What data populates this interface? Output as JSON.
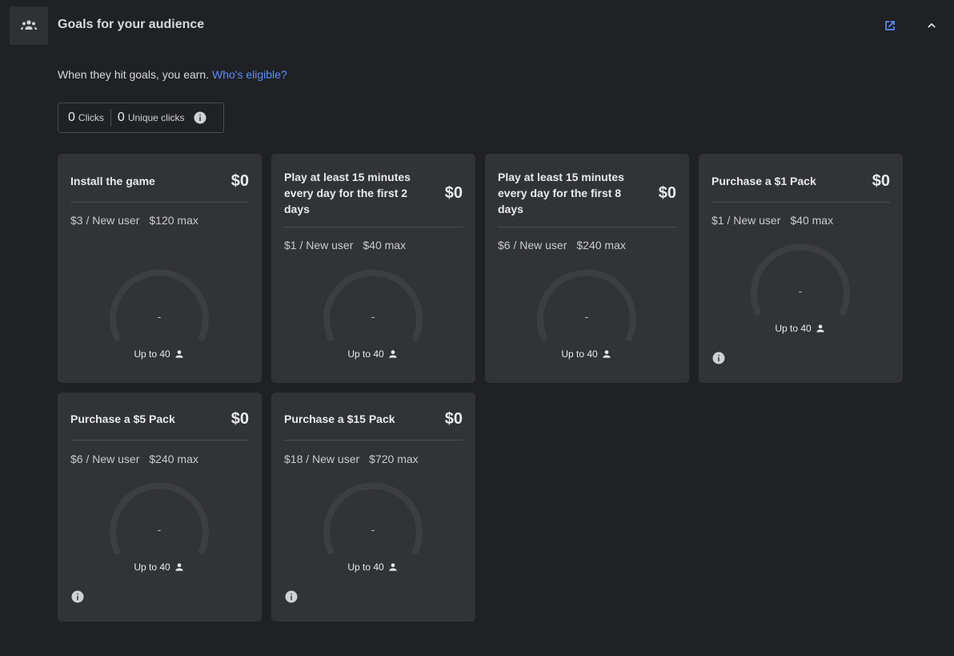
{
  "header": {
    "title": "Goals for your audience",
    "icon": "audience-group-icon",
    "external_icon": "open-in-new-icon",
    "collapse_icon": "chevron-up-icon"
  },
  "subtitle": {
    "text": "When they hit goals, you earn.",
    "link": "Who's eligible?"
  },
  "stats": {
    "clicks_value": "0",
    "clicks_label": "Clicks",
    "unique_value": "0",
    "unique_label": "Unique clicks"
  },
  "colors": {
    "background": "#202124",
    "card": "#323336",
    "link": "#5b8ff9",
    "gauge_track": "#3d3e42"
  },
  "goals": [
    {
      "title": "Install the game",
      "amount": "$0",
      "rate": "$3 / New user",
      "max": "$120 max",
      "gauge_value": "-",
      "gauge_caption": "Up to 40"
    },
    {
      "title": "Play at least 15 minutes every day for the first 2 days",
      "amount": "$0",
      "rate": "$1 / New user",
      "max": "$40 max",
      "gauge_value": "-",
      "gauge_caption": "Up to 40"
    },
    {
      "title": "Play at least 15 minutes every day for the first 8 days",
      "amount": "$0",
      "rate": "$6 / New user",
      "max": "$240 max",
      "gauge_value": "-",
      "gauge_caption": "Up to 40"
    },
    {
      "title": "Purchase a $1 Pack",
      "amount": "$0",
      "rate": "$1 / New user",
      "max": "$40 max",
      "gauge_value": "-",
      "gauge_caption": "Up to 40"
    },
    {
      "title": "Purchase a $5 Pack",
      "amount": "$0",
      "rate": "$6 / New user",
      "max": "$240 max",
      "gauge_value": "-",
      "gauge_caption": "Up to 40"
    },
    {
      "title": "Purchase a $15 Pack",
      "amount": "$0",
      "rate": "$18 / New user",
      "max": "$720 max",
      "gauge_value": "-",
      "gauge_caption": "Up to 40"
    }
  ]
}
